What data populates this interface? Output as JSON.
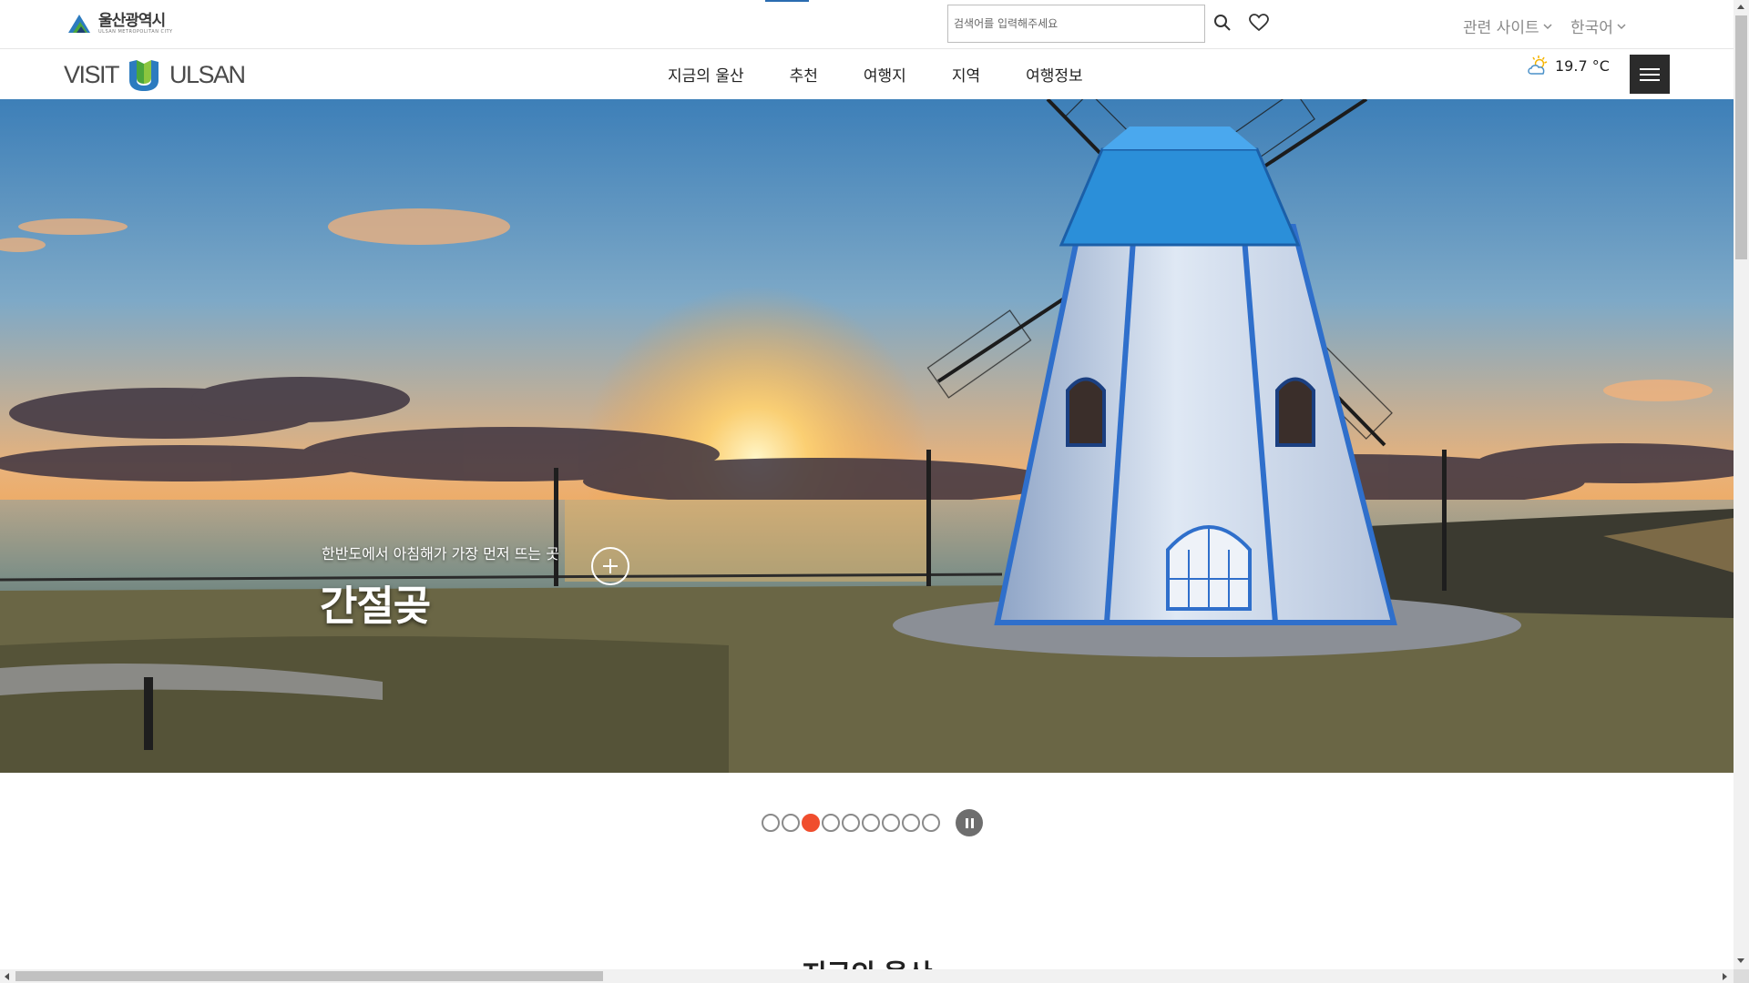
{
  "top_bar": {
    "city_logo_text": "울산광역시",
    "city_logo_sub": "ULSAN METROPOLITAN CITY",
    "search": {
      "placeholder": "검색어를 입력해주세요",
      "value": ""
    },
    "related_sites_label": "관련 사이트",
    "language_label": "한국어"
  },
  "header": {
    "brand_left": "VISIT",
    "brand_right": "ULSAN",
    "nav": [
      {
        "label": "지금의 울산"
      },
      {
        "label": "추천"
      },
      {
        "label": "여행지"
      },
      {
        "label": "지역"
      },
      {
        "label": "여행정보"
      }
    ],
    "weather": {
      "icon": "partly-cloudy-icon",
      "temperature": "19.7 °C"
    }
  },
  "hero": {
    "subtitle": "한반도에서 아침해가 가장 먼저 뜨는 곳",
    "title": "간절곶",
    "slides_total": 9,
    "active_slide": 3
  },
  "next_section": {
    "title": "지금의 울산"
  },
  "colors": {
    "accent": "#f04e2e",
    "menu_button": "#2b2b2b",
    "tab_indicator": "#2b6cb0",
    "logo_green": "#4aa63c",
    "logo_blue": "#2c7bbf"
  }
}
